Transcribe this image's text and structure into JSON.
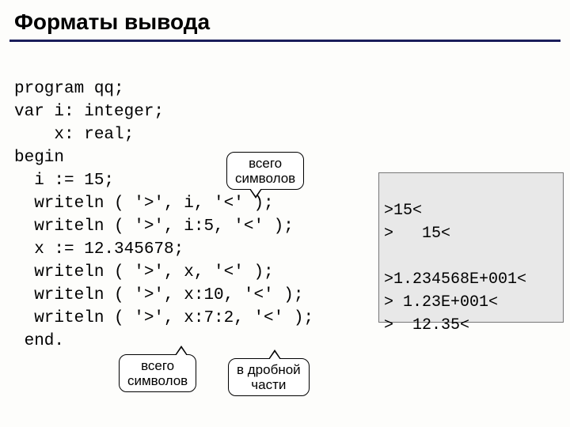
{
  "title": "Форматы вывода",
  "code_lines": [
    "program qq;",
    "var i: integer;",
    "    x: real;",
    "begin",
    "  i := 15;",
    "  writeln ( '>', i, '<' );",
    "  writeln ( '>', i:5, '<' );",
    "  x := 12.345678;",
    "  writeln ( '>', x, '<' );",
    "  writeln ( '>', x:10, '<' );",
    "  writeln ( '>', x:7:2, '<' );",
    " end."
  ],
  "output_lines": [
    ">15<",
    ">   15<",
    "",
    ">1.234568E+001<",
    "> 1.23E+001<",
    ">  12.35<"
  ],
  "callout1_l1": "всего",
  "callout1_l2": "символов",
  "callout2_l1": "всего",
  "callout2_l2": "символов",
  "callout3_l1": "в дробной",
  "callout3_l2": "части"
}
